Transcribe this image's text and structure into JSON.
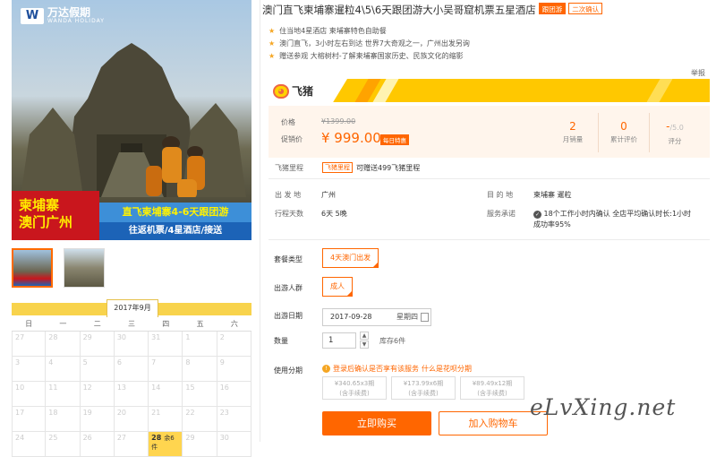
{
  "product_image": {
    "logo_text": "万达假期",
    "logo_sub": "WANDA HOLIDAY",
    "banner_red_line1": "柬埔寨",
    "banner_red_line2": "澳门广州",
    "banner_blue_line1": "直飞柬埔寨4-6天跟团游",
    "banner_blue_line2": "往返机票/4星酒店/接送"
  },
  "calendar": {
    "title": "2017年9月",
    "weekdays": [
      "日",
      "一",
      "二",
      "三",
      "四",
      "五",
      "六"
    ],
    "rows": [
      [
        "27",
        "28",
        "29",
        "30",
        "31",
        "1",
        "2"
      ],
      [
        "3",
        "4",
        "5",
        "6",
        "7",
        "8",
        "9"
      ],
      [
        "10",
        "11",
        "12",
        "13",
        "14",
        "15",
        "16"
      ],
      [
        "17",
        "18",
        "19",
        "20",
        "21",
        "22",
        "23"
      ],
      [
        "24",
        "25",
        "26",
        "27",
        "28",
        "29",
        "30"
      ]
    ],
    "available_day": "28",
    "available_remaining": "余6件"
  },
  "product": {
    "title": "澳门直飞柬埔寨暹粒4\\5\\6天跟团游大小吴哥窟机票五星酒店",
    "tag_group": "跟团游",
    "tag_confirm": "二次确认",
    "features": [
      "住当地4星酒店  柬埔寨特色自助餐",
      "澳门直飞，3小时左右到达  世界7大奇观之一，广州出发另询",
      "赠送参观  大榕树村-了解柬埔寨国家历史、民族文化的缩影"
    ],
    "report_label": "举报"
  },
  "brand": {
    "name": "飞猪",
    "icon_glyph": "◕"
  },
  "price": {
    "orig_label": "价格",
    "orig_value": "¥1399.00",
    "promo_label": "促销价",
    "promo_value": "¥ 999.00",
    "promo_tag": "每日特惠",
    "monthly_sales": "2",
    "monthly_sales_label": "月销量",
    "reviews": "0",
    "reviews_label": "累计评价",
    "rating": "-",
    "rating_max": "/5.0",
    "rating_label": "评分"
  },
  "mileage": {
    "label": "飞猪里程",
    "tag": "飞猪里程",
    "text": "可赠送499飞猪里程"
  },
  "details": {
    "depart_label": "出 发 地",
    "depart_value": "广州",
    "dest_label": "目 的 地",
    "dest_value": "柬埔寨  暹粒",
    "days_label": "行程天数",
    "days_value": "6天  5晚",
    "service_label": "服务承诺",
    "service_value_line1": "18个工作小时内确认 全店平均确认时长:1小时",
    "service_value_line2": "成功率95%"
  },
  "options": {
    "package_label": "套餐类型",
    "package_value": "4天澳门出发",
    "people_label": "出游人群",
    "people_value": "成人",
    "date_label": "出游日期",
    "date_value": "2017-09-28",
    "date_weekday": "星期四",
    "qty_label": "数量",
    "qty_value": "1",
    "qty_up": "▲",
    "qty_down": "▼",
    "stock": "库存6件",
    "installment_label": "使用分期",
    "installment_note_login": "登录后确认是否享有该服务",
    "installment_note_link": "什么是花呗分期",
    "plans": [
      {
        "amount": "¥340.65x3期",
        "fee": "(含手续费)"
      },
      {
        "amount": "¥173.99x6期",
        "fee": "(含手续费)"
      },
      {
        "amount": "¥89.49x12期",
        "fee": "(含手续费)"
      }
    ]
  },
  "actions": {
    "buy_now": "立即购买",
    "add_cart": "加入购物车"
  },
  "watermark": "eLvXing.net",
  "colors": {
    "accent": "#ff6600",
    "brand_yellow": "#ffc800",
    "calendar_yellow": "#f8d34c"
  }
}
